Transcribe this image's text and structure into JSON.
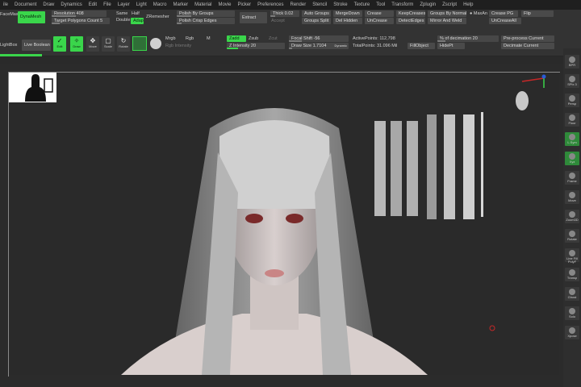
{
  "menubar": [
    "ile",
    "Document",
    "Draw",
    "Dynamics",
    "Edit",
    "File",
    "Layer",
    "Light",
    "Macro",
    "Marker",
    "Material",
    "Movie",
    "Picker",
    "Preferences",
    "Render",
    "Stencil",
    "Stroke",
    "Texture",
    "Tool",
    "Transform",
    "Zplugin",
    "Zscript",
    "Help"
  ],
  "left_tabs": {
    "facemask": "FaceMask",
    "lightbox": "LightBox",
    "live_boolean": "Live Boolean"
  },
  "dynamesh": {
    "button": "DynaMesh",
    "resolution": "Resolution 408",
    "target_polygons": "Target Polygons Count 5",
    "same": "Same",
    "half": "Half",
    "double": "Double",
    "adapt": "Adapt",
    "zremesher": "ZRemesher"
  },
  "polygroups": {
    "by_groups": "Polish By Groups",
    "crisp_edges": "Polish Crisp Edges"
  },
  "extract": {
    "button": "Extract",
    "thick": "Thick 0.02",
    "accept": "Accept"
  },
  "groups": {
    "auto_groups": "Auto Groups",
    "groups_split": "Groups Split",
    "merge_down": "MergeDown",
    "del_hidden": "Del Hidden",
    "crease": "Crease",
    "uncrease": "UnCrease",
    "keep_creases": "KeepCreases",
    "detect_edges": "DetectEdges",
    "groups_by_normals": "Groups By Normals",
    "maxang": "MaxAn",
    "mirror_and_weld": "Mirror And Weld",
    "crease_pg": "Crease PG",
    "uncrease_all": "UnCreaseAll",
    "flip": "Flip"
  },
  "draw_controls": {
    "edit": "Edit",
    "draw": "Draw",
    "move": "Move",
    "scale": "Scale",
    "rotate": "Rotate",
    "mrgb": "Mrgb",
    "rgb": "Rgb",
    "m": "M",
    "zadd": "Zadd",
    "zsub": "Zsub",
    "zcut": "Zcut",
    "rgb_intensity": "Rgb Intensity",
    "z_intensity": "Z Intensity 20"
  },
  "focal": {
    "focal_shift": "Focal Shift -56",
    "draw_size": "Draw Size 1.7104",
    "dynamic": "Dynamic"
  },
  "stats": {
    "active_points": "ActivePoints: 112,798",
    "total_points": "TotalPoints: 31.096 Mil",
    "fill_object": "FillObject",
    "hide_pt": "HidePt"
  },
  "decimation": {
    "pct": "% of decimation 20",
    "preprocess": "Pre-process Current",
    "decimate": "Decimate Current"
  },
  "side_buttons": [
    "BPR",
    "SPix 3",
    "Persp",
    "Floor",
    "L.Sym",
    "Xyz",
    "Frame",
    "Move",
    "Zoom3D",
    "Rotate",
    "Line Fill PolyF",
    "Transp",
    "Ghost",
    "Solo",
    "Xpose"
  ],
  "colors": {
    "accent": "#3ad64b",
    "bg": "#2b2b2b",
    "toolbar": "#333333",
    "cursor": "#c62828"
  }
}
